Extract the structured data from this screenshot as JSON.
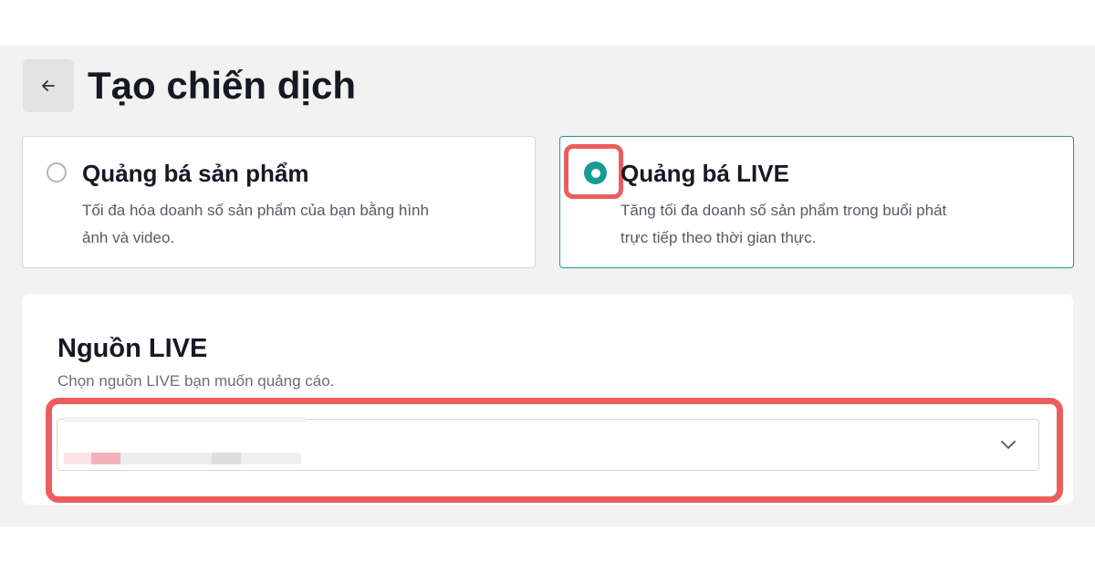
{
  "header": {
    "title": "Tạo chiến dịch",
    "back_icon": "arrow-left-icon"
  },
  "options": [
    {
      "title": "Quảng bá sản phẩm",
      "description": "Tối đa hóa doanh số sản phẩm của bạn bằng hình ảnh và video.",
      "selected": false
    },
    {
      "title": "Quảng bá LIVE",
      "description": "Tăng tối đa doanh số sản phẩm trong buổi phát trực tiếp theo thời gian thực.",
      "selected": true
    }
  ],
  "source": {
    "title": "Nguồn LIVE",
    "subtitle": "Chọn nguồn LIVE bạn muốn quảng cáo.",
    "dropdown_icon": "chevron-down-icon"
  },
  "colors": {
    "accent": "#1a9a96",
    "highlight": "#ec5d5d",
    "background": "#f2f2f2"
  }
}
